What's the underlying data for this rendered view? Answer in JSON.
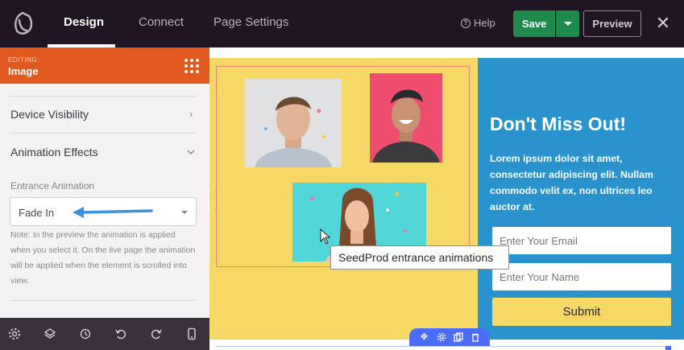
{
  "topbar": {
    "tabs": [
      {
        "label": "Design",
        "active": true
      },
      {
        "label": "Connect",
        "active": false
      },
      {
        "label": "Page Settings",
        "active": false
      }
    ],
    "help_label": "Help",
    "save_label": "Save",
    "preview_label": "Preview",
    "close_symbol": "✕"
  },
  "panel": {
    "editing_label": "EDITING:",
    "editing_title": "Image",
    "sections": [
      {
        "label": "Device Visibility",
        "state": "collapsed"
      },
      {
        "label": "Animation Effects",
        "state": "expanded"
      }
    ],
    "entrance_animation": {
      "label": "Entrance Animation",
      "value": "Fade In",
      "note": "Note: In the preview the animation is applied when you select it. On the live page the animation will be applied when the element is scrolled into view."
    }
  },
  "bottom_toolbar_icons": [
    "gear-icon",
    "layers-icon",
    "history-icon",
    "undo-icon",
    "redo-icon",
    "mobile-icon"
  ],
  "canvas": {
    "signup": {
      "title": "Don't Miss Out!",
      "body": "Lorem ipsum dolor sit amet, consectetur adipiscing elit. Nullam commodo velit ex, non ultrices leo auctor at.",
      "email_placeholder": "Enter Your Email",
      "name_placeholder": "Enter Your Name",
      "submit_label": "Submit"
    },
    "tooltip": "SeedProd entrance animations",
    "block_toolbar_icons": [
      "move-icon",
      "settings-icon",
      "duplicate-icon",
      "trash-icon"
    ]
  },
  "colors": {
    "topbar_bg": "#1f1523",
    "editing_header": "#e05a20",
    "save_green": "#1f8a4c",
    "yellow_section": "#f6d866",
    "blue_section": "#2893cd",
    "block_toolbar": "#4a6cf7",
    "arrow_blue": "#3d8fe0"
  }
}
